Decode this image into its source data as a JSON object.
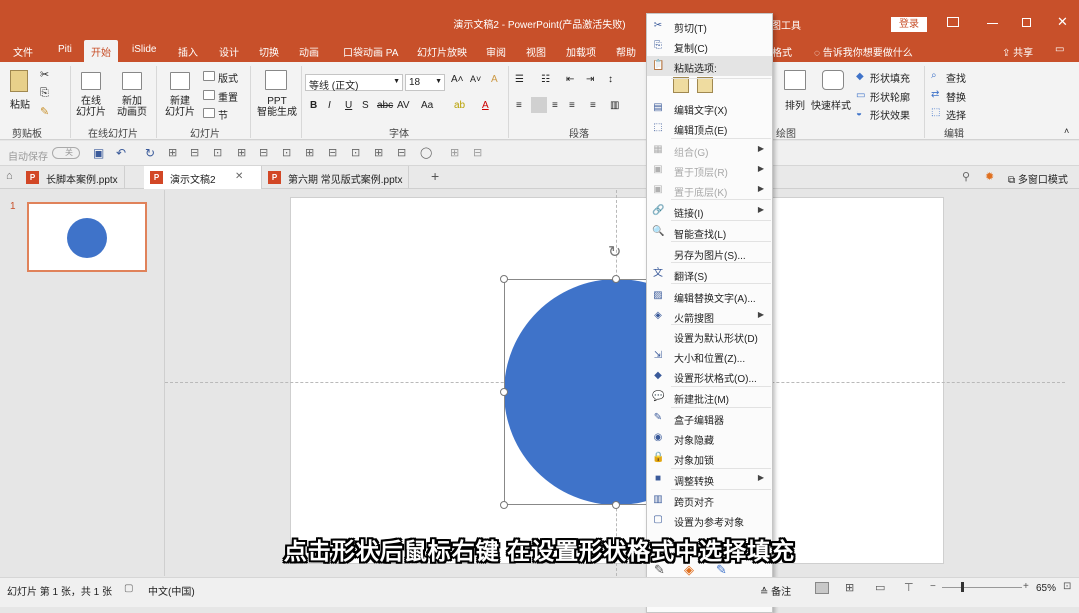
{
  "window": {
    "title": "演示文稿2  -  PowerPoint(产品激活失败)",
    "drawing_tools": "图工具",
    "login": "登录",
    "colors": {
      "accent": "#c8502a",
      "shape_fill": "#3f73c9"
    }
  },
  "tabs": [
    "文件",
    "Piti",
    "开始",
    "iSlide",
    "插入",
    "设计",
    "切换",
    "动画",
    "口袋动画 PA",
    "幻灯片放映",
    "审阅",
    "视图",
    "加载项",
    "帮助",
    "格式"
  ],
  "tell_me": "告诉我你想要做什么",
  "share": "共享",
  "ribbon": {
    "clipboard": {
      "paste": "粘贴",
      "label": "剪贴板"
    },
    "online": {
      "online_slide": "在线\n幻灯片",
      "new_anim_page": "新加\n动画页",
      "label": "在线幻灯片"
    },
    "slides": {
      "new_slide": "新建\n幻灯片",
      "layout": "版式",
      "reset": "重置",
      "section": "节",
      "label": "幻灯片"
    },
    "ppt_smart": "PPT\n智能生成",
    "font": {
      "name": "等线 (正文)",
      "size": "18",
      "label": "字体"
    },
    "paragraph": {
      "label": "段落"
    },
    "drawing": {
      "arrange": "排列",
      "quick_styles": "快速样式",
      "shape_fill": "形状填充",
      "shape_outline": "形状轮廓",
      "shape_effects": "形状效果",
      "label": "绘图"
    },
    "editing": {
      "find": "查找",
      "replace": "替换",
      "select": "选择",
      "label": "编辑"
    }
  },
  "qat": {
    "autosave": "自动保存",
    "off": "关"
  },
  "doc_tabs": [
    "长脚本案例.pptx",
    "演示文稿2",
    "第六期  常见版式案例.pptx"
  ],
  "multi_window": "多窗口模式",
  "slide_number": "1",
  "context_menu": [
    {
      "icon": "cut-icon",
      "glyph": "✂",
      "label": "剪切(T)",
      "disabled": false
    },
    {
      "icon": "copy-icon",
      "glyph": "⎘",
      "label": "复制(C)",
      "disabled": false
    },
    {
      "icon": "paste-icon",
      "glyph": "📋",
      "label": "粘贴选项:",
      "disabled": false,
      "highlight": true
    },
    {
      "icon": "edit-text-icon",
      "glyph": "▤",
      "label": "编辑文字(X)",
      "disabled": false
    },
    {
      "icon": "edit-points-icon",
      "glyph": "⬚",
      "label": "编辑顶点(E)",
      "disabled": false
    },
    {
      "icon": "group-icon",
      "glyph": "▦",
      "label": "组合(G)",
      "disabled": true,
      "submenu": true
    },
    {
      "icon": "bring-front-icon",
      "glyph": "▣",
      "label": "置于顶层(R)",
      "disabled": true,
      "submenu": true
    },
    {
      "icon": "send-back-icon",
      "glyph": "▣",
      "label": "置于底层(K)",
      "disabled": true,
      "submenu": true
    },
    {
      "icon": "link-icon",
      "glyph": "🔗",
      "label": "链接(I)",
      "disabled": false,
      "submenu": true
    },
    {
      "icon": "smart-lookup-icon",
      "glyph": "🔍",
      "label": "智能查找(L)",
      "disabled": false
    },
    {
      "icon": "",
      "glyph": "",
      "label": "另存为图片(S)...",
      "disabled": false
    },
    {
      "icon": "translate-icon",
      "glyph": "文",
      "label": "翻译(S)",
      "disabled": false
    },
    {
      "icon": "alt-text-icon",
      "glyph": "▨",
      "label": "编辑替换文字(A)...",
      "disabled": false
    },
    {
      "icon": "image-search-icon",
      "glyph": "◈",
      "label": "火箭搜图",
      "disabled": false,
      "submenu": true
    },
    {
      "icon": "",
      "glyph": "",
      "label": "设置为默认形状(D)",
      "disabled": false
    },
    {
      "icon": "size-position-icon",
      "glyph": "⇲",
      "label": "大小和位置(Z)...",
      "disabled": false
    },
    {
      "icon": "format-shape-icon",
      "glyph": "◆",
      "label": "设置形状格式(O)...",
      "disabled": false
    },
    {
      "icon": "new-comment-icon",
      "glyph": "💬",
      "label": "新建批注(M)",
      "disabled": false
    },
    {
      "icon": "box-editor-icon",
      "glyph": "✎",
      "label": "盒子编辑器",
      "disabled": false
    },
    {
      "icon": "hide-object-icon",
      "glyph": "◉",
      "label": "对象隐藏",
      "disabled": false
    },
    {
      "icon": "lock-object-icon",
      "glyph": "🔒",
      "label": "对象加锁",
      "disabled": false
    },
    {
      "icon": "adjust-convert-icon",
      "glyph": "■",
      "label": "调整转换",
      "disabled": false,
      "submenu": true
    },
    {
      "icon": "cross-page-align-icon",
      "glyph": "▥",
      "label": "跨页对齐",
      "disabled": false
    },
    {
      "icon": "set-reference-icon",
      "glyph": "▢",
      "label": "设置为参考对象",
      "disabled": false
    }
  ],
  "mini_toolbar": [
    "样式",
    "填充",
    "边框"
  ],
  "subtitle": "点击形状后鼠标右键 在设置形状格式中选择填充",
  "status": {
    "slide_info": "幻灯片 第 1 张，共 1 张",
    "language": "中文(中国)",
    "notes": "备注",
    "zoom": "65%"
  }
}
